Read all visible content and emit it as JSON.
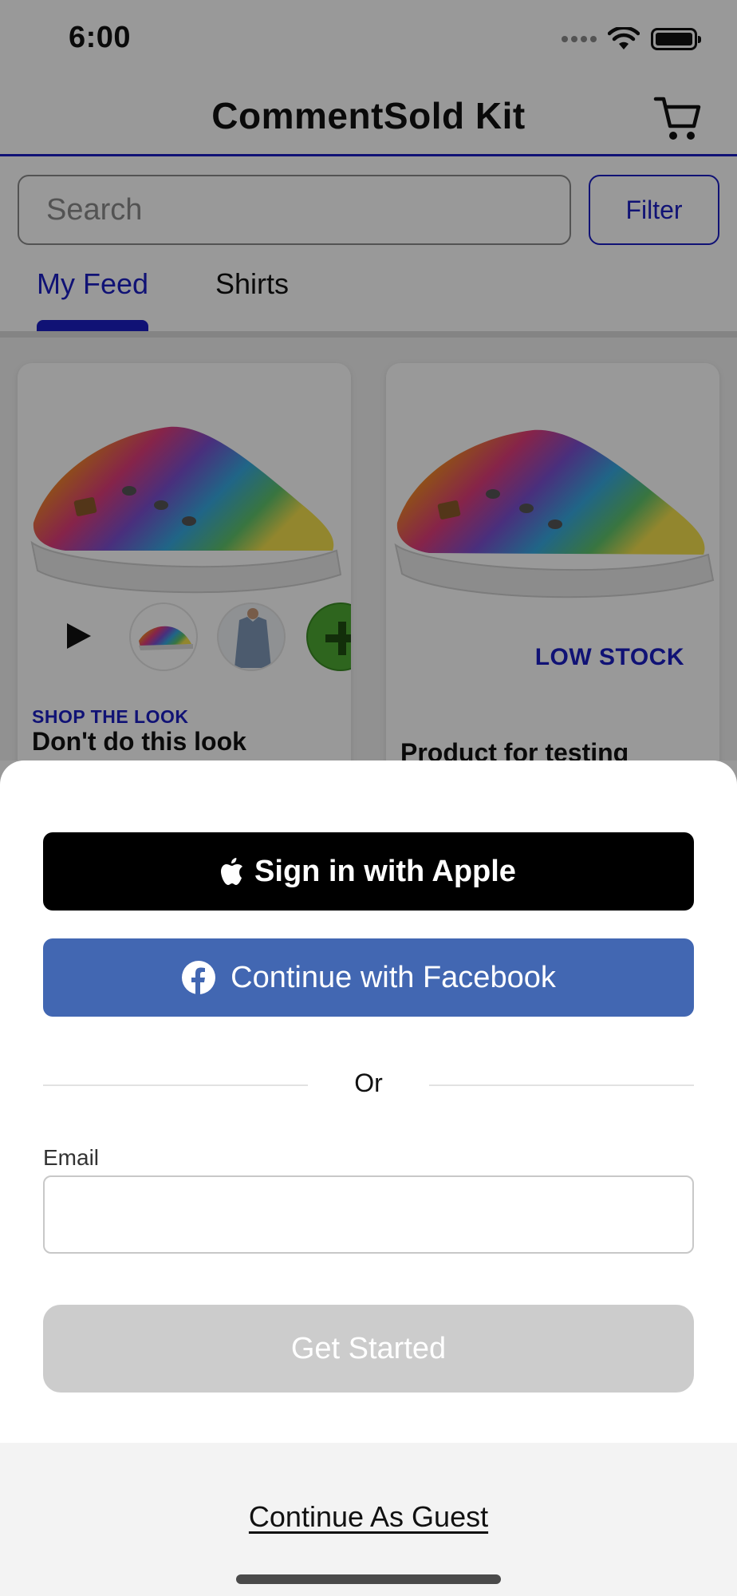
{
  "status_bar": {
    "time": "6:00"
  },
  "header": {
    "title": "CommentSold Kit"
  },
  "search": {
    "placeholder": "Search",
    "filter_label": "Filter"
  },
  "tabs": [
    {
      "label": "My Feed",
      "active": true
    },
    {
      "label": "Shirts",
      "active": false
    }
  ],
  "feed": {
    "cards": [
      {
        "kicker": "SHOP THE LOOK",
        "title": "Don't do this look",
        "badge": ""
      },
      {
        "kicker": "",
        "title": "Product for testing waitlists",
        "badge": "LOW STOCK"
      }
    ]
  },
  "sheet": {
    "apple_label": "Sign in with Apple",
    "facebook_label": "Continue with Facebook",
    "divider_text": "Or",
    "email_label": "Email",
    "email_value": "",
    "get_started_label": "Get Started",
    "guest_label": "Continue As Guest"
  },
  "icons": {
    "cart": "cart-icon",
    "apple": "apple-logo-icon",
    "facebook": "facebook-logo-icon",
    "play": "play-icon"
  },
  "colors": {
    "accent": "#1c1fc4",
    "facebook": "#4267b2",
    "apple_button": "#000000",
    "disabled_button": "#cccccc",
    "guest_background": "#f3f3f3"
  }
}
